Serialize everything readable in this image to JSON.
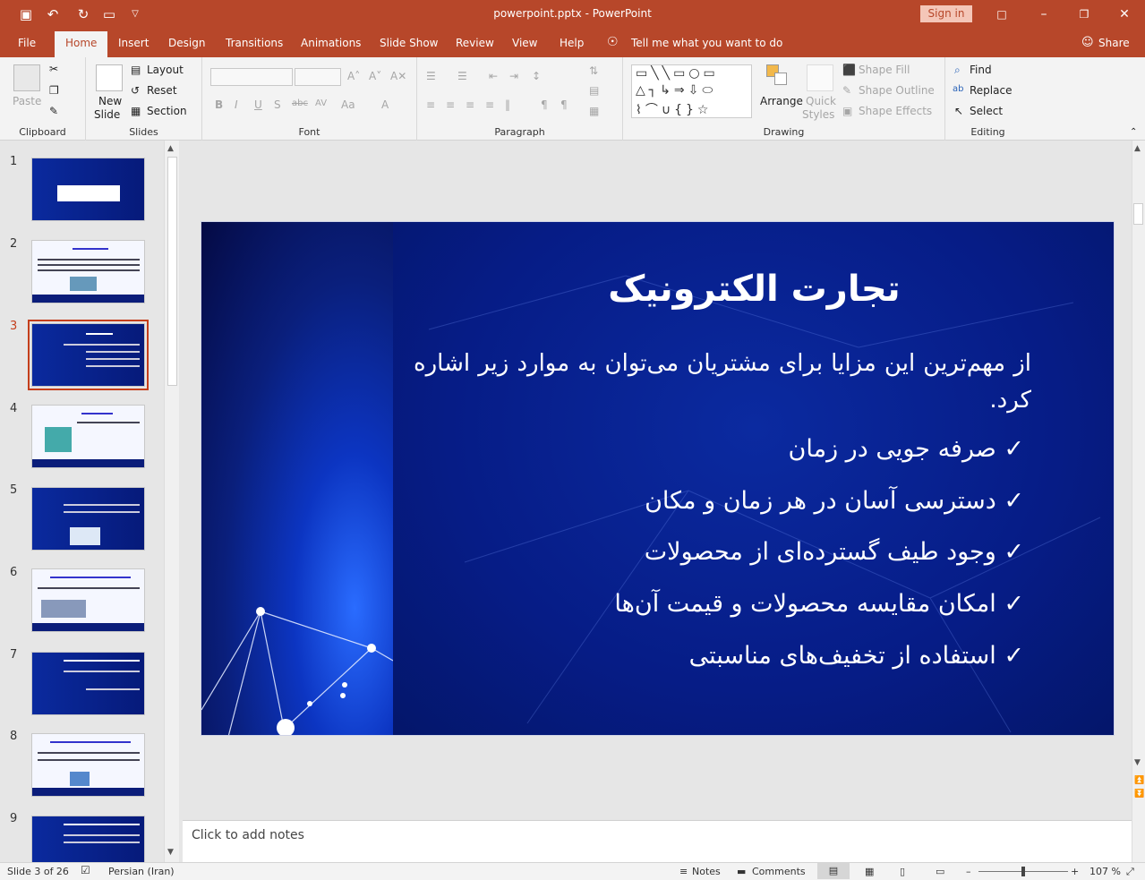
{
  "window": {
    "title": "powerpoint.pptx  -  PowerPoint",
    "signin_label": "Sign in"
  },
  "tabs": [
    "File",
    "Home",
    "Insert",
    "Design",
    "Transitions",
    "Animations",
    "Slide Show",
    "Review",
    "View",
    "Help"
  ],
  "tell_me": "Tell me what you want to do",
  "share_label": "Share",
  "ribbon": {
    "clipboard": {
      "label": "Clipboard",
      "paste": "Paste"
    },
    "slides": {
      "label": "Slides",
      "new_slide_1": "New",
      "new_slide_2": "Slide",
      "layout": "Layout",
      "reset": "Reset",
      "section": "Section"
    },
    "font": {
      "label": "Font"
    },
    "paragraph": {
      "label": "Paragraph"
    },
    "drawing": {
      "label": "Drawing",
      "arrange": "Arrange",
      "quick_styles_1": "Quick",
      "quick_styles_2": "Styles",
      "shape_fill": "Shape Fill",
      "shape_outline": "Shape Outline",
      "shape_effects": "Shape Effects"
    },
    "editing": {
      "label": "Editing",
      "find": "Find",
      "replace": "Replace",
      "select": "Select"
    }
  },
  "thumbnails": [
    {
      "num": "1",
      "style": "blue"
    },
    {
      "num": "2",
      "style": "white"
    },
    {
      "num": "3",
      "style": "blue",
      "selected": true
    },
    {
      "num": "4",
      "style": "white"
    },
    {
      "num": "5",
      "style": "blue"
    },
    {
      "num": "6",
      "style": "white"
    },
    {
      "num": "7",
      "style": "blue"
    },
    {
      "num": "8",
      "style": "white"
    },
    {
      "num": "9",
      "style": "blue"
    }
  ],
  "slide": {
    "title": "تجارت الکترونیک",
    "body": "از مهم‌ترین این مزایا برای مشتریان می‌توان به موارد زیر اشاره کرد.",
    "bullets": [
      "صرفه جویی در زمان",
      "دسترسی آسان در هر زمان و مکان",
      "وجود طیف گسترده‌ای از محصولات",
      "امکان مقایسه محصولات و قیمت آن‌ها",
      "استفاده از تخفیف‌های مناسبتی"
    ],
    "check": "✓"
  },
  "notes_placeholder": "Click to add notes",
  "status": {
    "slide_count": "Slide 3 of 26",
    "language": "Persian (Iran)",
    "notes": "Notes",
    "comments": "Comments",
    "zoom": "107 %"
  }
}
